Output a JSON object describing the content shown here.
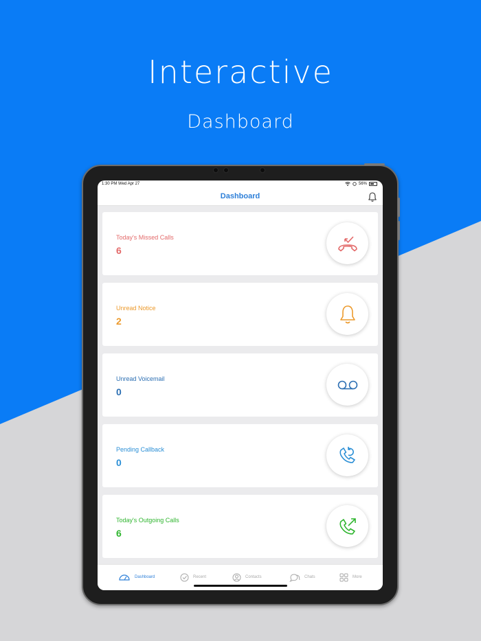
{
  "hero": {
    "title": "Interactive",
    "subtitle": "Dashboard"
  },
  "status_bar": {
    "time_date": "1:30 PM  Wed Apr 27",
    "battery": "56%"
  },
  "header": {
    "title": "Dashboard",
    "bell_icon": "bell-icon"
  },
  "cards": [
    {
      "label": "Today's Missed Calls",
      "value": "6",
      "color": "#e36a6a",
      "icon": "missed-call-icon"
    },
    {
      "label": "Unread Notice",
      "value": "2",
      "color": "#ec9a2c",
      "icon": "bell-icon"
    },
    {
      "label": "Unread Voicemail",
      "value": "0",
      "color": "#2c6fb3",
      "icon": "voicemail-icon"
    },
    {
      "label": "Pending Callback",
      "value": "0",
      "color": "#2b8fd6",
      "icon": "callback-icon"
    },
    {
      "label": "Today's Outgoing Calls",
      "value": "6",
      "color": "#2fb52f",
      "icon": "outgoing-call-icon"
    }
  ],
  "tabs": [
    {
      "label": "Dashboard",
      "icon": "dashboard-icon",
      "active": true
    },
    {
      "label": "Recent",
      "icon": "clock-icon",
      "active": false
    },
    {
      "label": "Contacts",
      "icon": "contacts-icon",
      "active": false
    },
    {
      "label": "Chats",
      "icon": "chat-icon",
      "active": false
    },
    {
      "label": "More",
      "icon": "grid-icon",
      "active": false
    }
  ],
  "colors": {
    "brand_blue": "#0a7cf6",
    "background_gray": "#d6d6d8",
    "accent": "#2d7fd8"
  }
}
